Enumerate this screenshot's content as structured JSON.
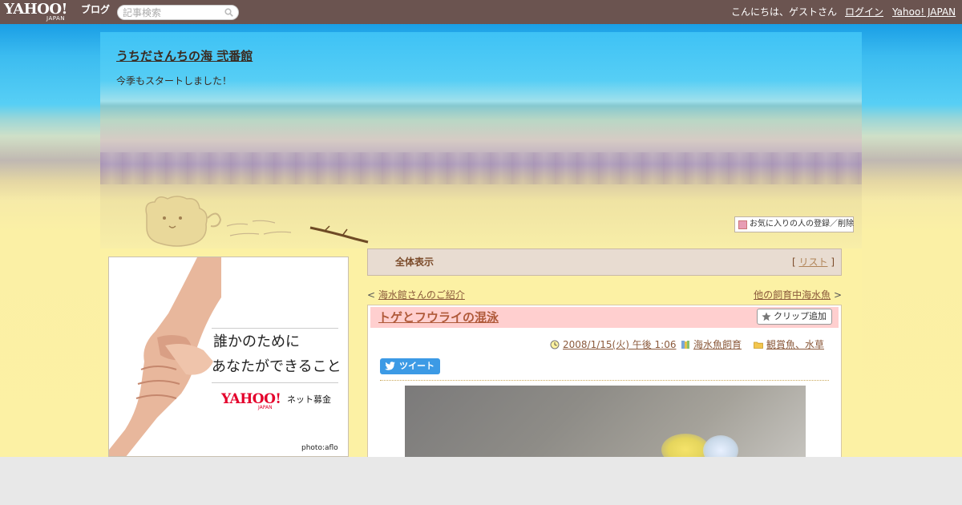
{
  "topbar": {
    "logo_text": "YAHOO!",
    "logo_sub": "JAPAN",
    "logo_blog": "ブログ",
    "search_placeholder": "記事検索",
    "greeting": "こんにちは、ゲストさん",
    "login_label": "ログイン",
    "yahoo_japan_label": "Yahoo! JAPAN"
  },
  "blog": {
    "title": "うちださんちの海 弐番館",
    "description": "今季もスタートしました！",
    "favorite_button": "お気に入りの人の登録／削除"
  },
  "ad": {
    "copy_line1": "誰かのために",
    "copy_line2": "あなたができること",
    "logo_text": "YAHOO!",
    "logo_sub": "JAPAN",
    "logo_label": "ネット募金",
    "credit": "photo:aflo"
  },
  "tabbar": {
    "all_label": "全体表示",
    "list_label": "リスト",
    "list_open": "[ ",
    "list_close": " ]"
  },
  "nav": {
    "prev_arrow": "< ",
    "prev_label": "海水館さんのご紹介",
    "next_label": "他の飼育中海水魚",
    "next_arrow": " >"
  },
  "article": {
    "title": "トゲとフウライの混泳",
    "clip_label": "クリップ追加",
    "date": "2008/1/15(火) 午後 1:06",
    "category": "海水魚飼育",
    "folder": "観賞魚、水草",
    "tweet_label": "ツイート"
  },
  "colors": {
    "topbar": "#6b5450",
    "link_brown": "#8b5a3c",
    "article_header": "#ffcfcf",
    "tweet_blue": "#3c9ae5",
    "yahoo_red": "#e4002b"
  }
}
